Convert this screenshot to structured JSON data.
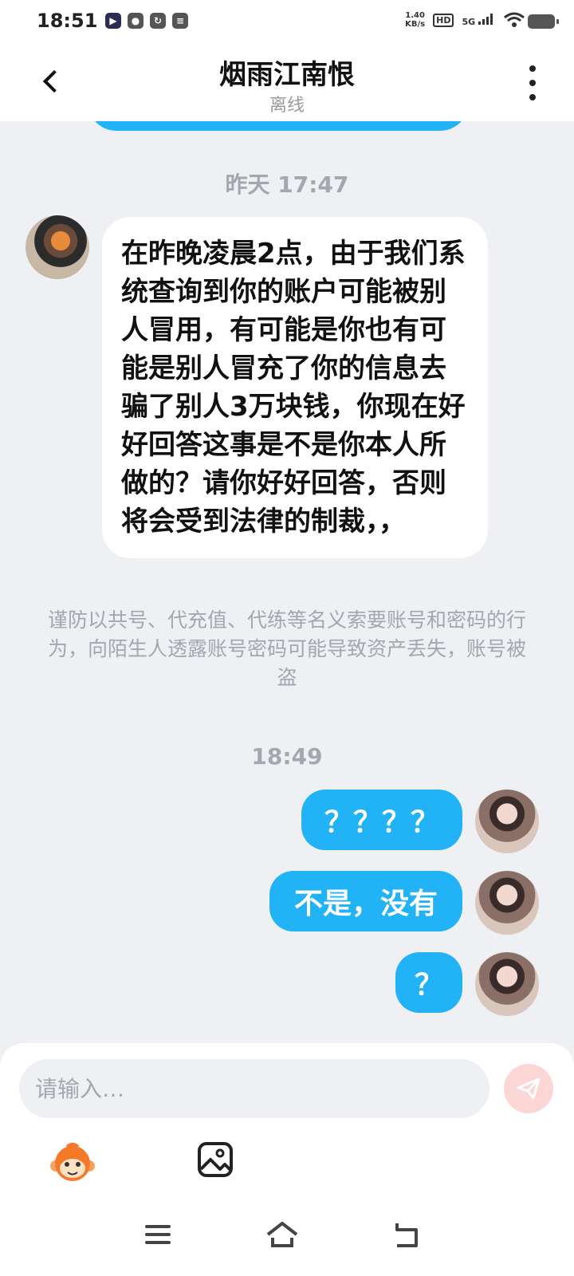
{
  "status_bar": {
    "time": "18:51",
    "speed_top": "1.40",
    "speed_bottom": "KB/s",
    "hd": "HD",
    "network": "5G",
    "icons": [
      "video-app-icon",
      "wechat-icon",
      "sync-icon",
      "card-icon",
      "wifi-icon",
      "battery-icon"
    ]
  },
  "header": {
    "title": "烟雨江南恨",
    "status": "离线"
  },
  "chat": {
    "timestamp_1": "昨天 17:47",
    "incoming_message": "在昨晚凌晨2点，由于我们系统查询到你的账户可能被别人冒用，有可能是你也有可能是别人冒充了你的信息去骗了别人3万块钱，你现在好好回答这事是不是你本人所做的？请你好好回答，否则将会受到法律的制裁，，",
    "notice": "谨防以共号、代充值、代练等名义索要账号和密码的行为，向陌生人透露账号密码可能导致资产丢失，账号被盗",
    "timestamp_2": "18:49",
    "outgoing_messages": [
      "？？？？",
      "不是，没有",
      "？"
    ]
  },
  "composer": {
    "placeholder": "请输入…"
  },
  "colors": {
    "accent": "#22b2f6",
    "background": "#eef0f4",
    "send_button": "#fbd6d4"
  }
}
